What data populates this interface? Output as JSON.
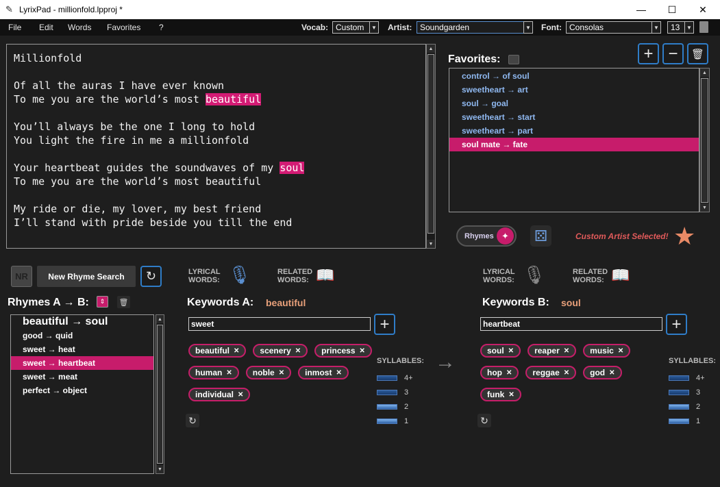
{
  "window": {
    "title": "LyrixPad - millionfold.lpproj *",
    "app_icon": "feather-icon"
  },
  "menu": [
    "File",
    "Edit",
    "Words",
    "Favorites",
    "?"
  ],
  "toolbar": {
    "vocab_label": "Vocab:",
    "vocab_value": "Custom",
    "artist_label": "Artist:",
    "artist_value": "Soundgarden",
    "font_label": "Font:",
    "font_value": "Consolas",
    "font_size": "13"
  },
  "editor": {
    "lines": [
      "Millionfold",
      "",
      "Of all the auras I have ever known",
      "To me you are the world’s most |beautiful|",
      "",
      "You’ll always be the one I long to hold",
      "You light the fire in me a millionfold",
      "",
      "Your heartbeat guides the soundwaves of my |soul|",
      "To me you are the world’s most beautiful",
      "",
      "My ride or die, my lover, my best friend",
      "I’ll stand with pride beside you till the end"
    ]
  },
  "favorites": {
    "title": "Favorites:",
    "items": [
      "control → of soul",
      "sweetheart → art",
      "soul → goal",
      "sweetheart → start",
      "sweetheart → part",
      "soul mate → fate"
    ],
    "selected_index": 5
  },
  "rhymes_toggle": {
    "label": "Rhymes"
  },
  "custom_artist_msg": "Custom Artist Selected!",
  "new_rhyme_search": {
    "nr_badge": "NR",
    "label": "New Rhyme Search"
  },
  "lyrical_words_label": [
    "LYRICAL",
    "WORDS:"
  ],
  "related_words_label": [
    "RELATED",
    "WORDS:"
  ],
  "rhymes_ab": {
    "title": "Rhymes A → B:",
    "header": "beautiful → soul",
    "items": [
      "good → quid",
      "sweet → heat",
      "sweet → heartbeat",
      "sweet → meat",
      "perfect → object"
    ],
    "selected_index": 2
  },
  "keywords_a": {
    "title": "Keywords A:",
    "value": "beautiful",
    "input": "sweet",
    "tags": [
      "beautiful",
      "scenery",
      "princess",
      "human",
      "noble",
      "inmost",
      "individual"
    ]
  },
  "keywords_b": {
    "title": "Keywords B:",
    "value": "soul",
    "input": "heartbeat",
    "tags": [
      "soul",
      "reaper",
      "music",
      "hop",
      "reggae",
      "god",
      "funk"
    ]
  },
  "syllables": {
    "label": "SYLLABLES:",
    "levels": [
      "4+",
      "3",
      "2",
      "1"
    ]
  },
  "colors": {
    "accent": "#c71c6b",
    "blue": "#2f7dc8",
    "fav_text": "#8fb8f0",
    "keyword": "#e8a07a",
    "star": "#e88a66",
    "msg": "#e05a5a"
  }
}
